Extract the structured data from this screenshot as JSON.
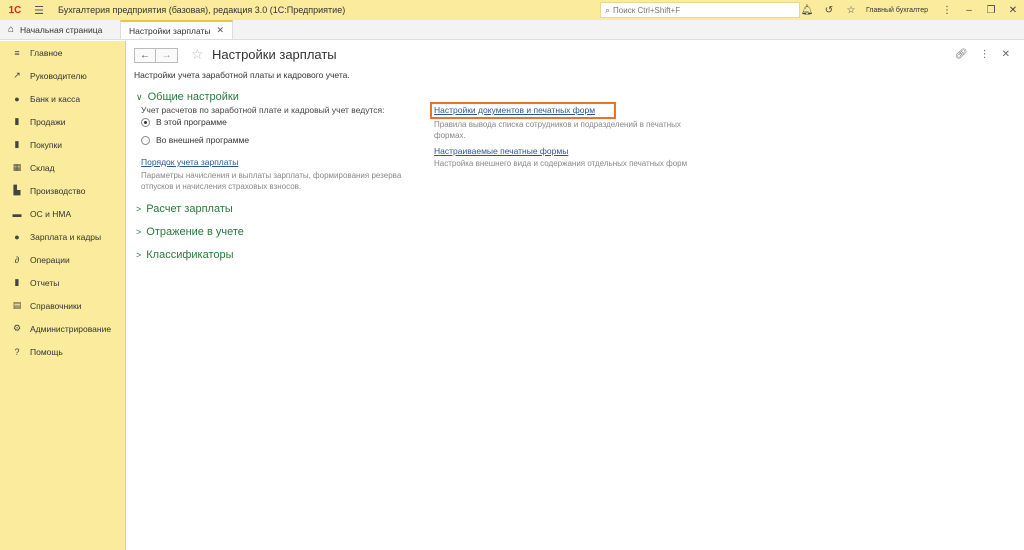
{
  "titlebar": {
    "logo": "1С",
    "title": "Бухгалтерия предприятия (базовая), редакция 3.0  (1С:Предприятие)",
    "search_placeholder": "Поиск Ctrl+Shift+F",
    "user": "Главный бухгалтер"
  },
  "tabs": [
    {
      "label": "Начальная страница"
    },
    {
      "label": "Настройки зарплаты"
    }
  ],
  "sidebar": {
    "items": [
      {
        "label": "Главное",
        "icon": "≡"
      },
      {
        "label": "Руководителю",
        "icon": "↗"
      },
      {
        "label": "Банк и касса",
        "icon": "●"
      },
      {
        "label": "Продажи",
        "icon": "▮"
      },
      {
        "label": "Покупки",
        "icon": "▮"
      },
      {
        "label": "Склад",
        "icon": "▦"
      },
      {
        "label": "Производство",
        "icon": "▙"
      },
      {
        "label": "ОС и НМА",
        "icon": "▬"
      },
      {
        "label": "Зарплата и кадры",
        "icon": "●"
      },
      {
        "label": "Операции",
        "icon": "∂"
      },
      {
        "label": "Отчеты",
        "icon": "▮"
      },
      {
        "label": "Справочники",
        "icon": "▤"
      },
      {
        "label": "Администрирование",
        "icon": "⚙"
      },
      {
        "label": "Помощь",
        "icon": "?"
      }
    ]
  },
  "main": {
    "title": "Настройки зарплаты",
    "subtitle": "Настройки учета заработной платы и кадрового учета.",
    "sections": {
      "general": "Общие настройки",
      "payroll": "Расчет зарплаты",
      "accounting": "Отражение в учете",
      "classifiers": "Классификаторы"
    },
    "accounting_label": "Учет расчетов по заработной плате и кадровый учет ведутся:",
    "radio": {
      "in_program": "В этой программе",
      "external": "Во внешней программе"
    },
    "links": {
      "order": "Порядок учета зарплаты",
      "order_desc": "Параметры начисления и выплаты зарплаты, формирования резерва отпусков и начисления страховых взносов.",
      "docs": "Настройки документов и печатных форм",
      "docs_desc": "Правила вывода списка сотрудников и подразделений в печатных формах.",
      "print": "Настраиваемые печатные формы",
      "print_desc": "Настройка внешнего вида и содержания отдельных печатных форм"
    }
  }
}
